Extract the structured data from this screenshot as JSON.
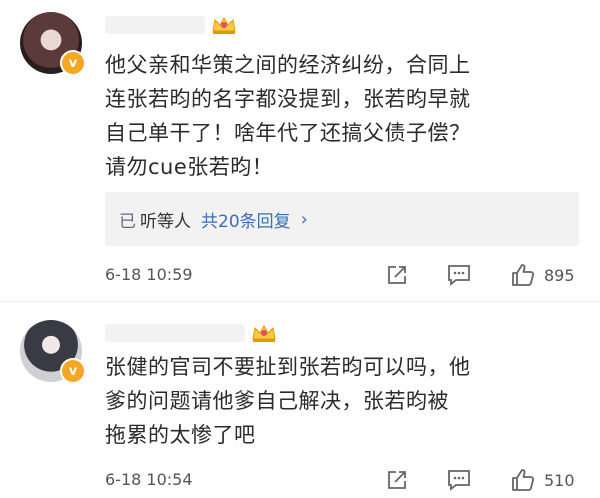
{
  "comments": [
    {
      "text": "他父亲和华策之间的经济纠纷，合同上\n连张若昀的名字都没提到，张若昀早就\n自己单干了！啥年代了还搞父债子偿？\n请勿cue张若昀！",
      "replies": {
        "user_prefix": "已",
        "user_suffix": "听等人",
        "count_label": "共20条回复",
        "chevron": "›"
      },
      "time": "6-18 10:59",
      "likes": "895",
      "verified_mark": "v"
    },
    {
      "text": "张健的官司不要扯到张若昀可以吗，他\n爹的问题请他爹自己解决，张若昀被\n拖累的太惨了吧",
      "time": "6-18 10:54",
      "likes": "510",
      "verified_mark": "v"
    }
  ],
  "colors": {
    "link_blue": "#3b6fb6",
    "reply_bg": "#f2f2f2",
    "badge_gold": "#f5a623"
  },
  "icons": [
    "crown-badge-icon",
    "share-icon",
    "comment-icon",
    "like-icon",
    "verified-icon"
  ]
}
